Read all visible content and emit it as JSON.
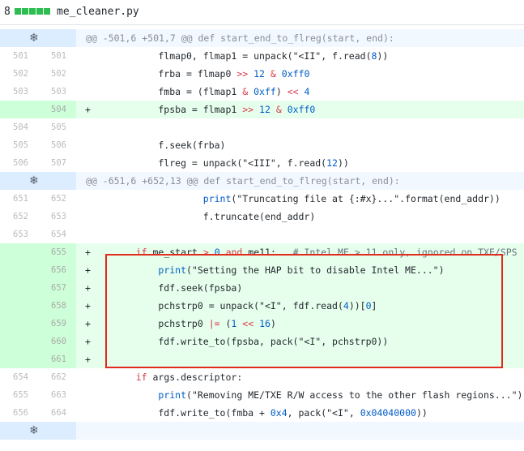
{
  "file": {
    "change_count": "8",
    "name": "me_cleaner.py",
    "color_added": "#2cbe4e"
  },
  "expand_icon": "unfold-icon",
  "rows": [
    {
      "type": "hunk",
      "text": "@@ -501,6 +501,7 @@ def start_end_to_flreg(start, end):"
    },
    {
      "type": "normal",
      "old": "501",
      "new": "501",
      "code": "        flmap0, flmap1 = unpack(\"<II\", f.read(8))"
    },
    {
      "type": "normal",
      "old": "502",
      "new": "502",
      "code": "        frba = flmap0 >> 12 & 0xff0"
    },
    {
      "type": "normal",
      "old": "503",
      "new": "503",
      "code": "        fmba = (flmap1 & 0xff) << 4"
    },
    {
      "type": "added",
      "old": "",
      "new": "504",
      "code": "        fpsba = flmap1 >> 12 & 0xff0"
    },
    {
      "type": "normal",
      "old": "504",
      "new": "505",
      "code": ""
    },
    {
      "type": "normal",
      "old": "505",
      "new": "506",
      "code": "        f.seek(frba)"
    },
    {
      "type": "normal",
      "old": "506",
      "new": "507",
      "code": "        flreg = unpack(\"<III\", f.read(12))"
    },
    {
      "type": "hunk",
      "text": "@@ -651,6 +652,13 @@ def start_end_to_flreg(start, end):"
    },
    {
      "type": "normal",
      "old": "651",
      "new": "652",
      "code": "                print(\"Truncating file at {:#x}...\".format(end_addr))"
    },
    {
      "type": "normal",
      "old": "652",
      "new": "653",
      "code": "                f.truncate(end_addr)"
    },
    {
      "type": "normal",
      "old": "653",
      "new": "654",
      "code": ""
    },
    {
      "type": "added",
      "old": "",
      "new": "655",
      "code": "    if me_start > 0 and me11:   # Intel ME > 11 only, ignored on TXE/SPS"
    },
    {
      "type": "added",
      "old": "",
      "new": "656",
      "code": "        print(\"Setting the HAP bit to disable Intel ME...\")"
    },
    {
      "type": "added",
      "old": "",
      "new": "657",
      "code": "        fdf.seek(fpsba)"
    },
    {
      "type": "added",
      "old": "",
      "new": "658",
      "code": "        pchstrp0 = unpack(\"<I\", fdf.read(4))[0]"
    },
    {
      "type": "added",
      "old": "",
      "new": "659",
      "code": "        pchstrp0 |= (1 << 16)"
    },
    {
      "type": "added",
      "old": "",
      "new": "660",
      "code": "        fdf.write_to(fpsba, pack(\"<I\", pchstrp0))"
    },
    {
      "type": "added",
      "old": "",
      "new": "661",
      "code": ""
    },
    {
      "type": "normal",
      "old": "654",
      "new": "662",
      "code": "    if args.descriptor:"
    },
    {
      "type": "normal",
      "old": "655",
      "new": "663",
      "code": "        print(\"Removing ME/TXE R/W access to the other flash regions...\")"
    },
    {
      "type": "normal",
      "old": "656",
      "new": "664",
      "code": "        fdf.write_to(fmba + 0x4, pack(\"<I\", 0x04040000))"
    },
    {
      "type": "hunk",
      "text": ""
    }
  ]
}
